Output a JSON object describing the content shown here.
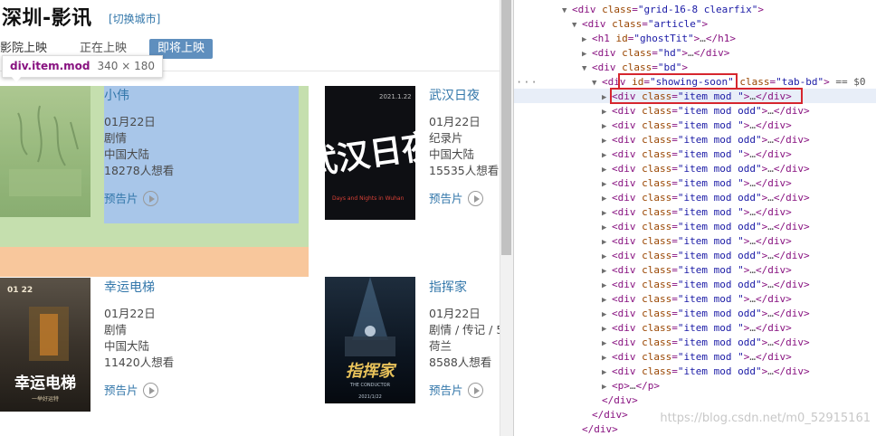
{
  "header": {
    "city_title": "深圳-影讯",
    "switch_city": "[切换城市]",
    "tabs": [
      "影院上映",
      "正在上映",
      "即将上映"
    ]
  },
  "tooltip": {
    "selector": "div.item.mod",
    "size": "340 × 180"
  },
  "movies": [
    {
      "title": "小伟",
      "date": "01月22日",
      "genre": "剧情",
      "region": "中国大陆",
      "wish": "18278人想看",
      "trailer": "预告片"
    },
    {
      "title": "武汉日夜",
      "date": "01月22日",
      "genre": "纪录片",
      "region": "中国大陆",
      "wish": "15535人想看",
      "trailer": "预告片"
    },
    {
      "title": "幸运电梯",
      "date": "01月22日",
      "genre": "剧情",
      "region": "中国大陆",
      "wish": "11420人想看",
      "trailer": "预告片"
    },
    {
      "title": "指挥家",
      "date": "01月22日",
      "genre": "剧情 / 传记 / 5",
      "region": "荷兰",
      "wish": "8588人想看",
      "trailer": "预告片"
    }
  ],
  "poster_text": {
    "p2_top": "2021.1.22",
    "p2_big": "武汉日夜",
    "p2_en": "Days and Nights in Wuhan",
    "p3_date": "01 22",
    "p3_big": "幸运电梯",
    "p3_sub": "一举好运特",
    "p4_big": "指挥家",
    "p4_en": "THE CONDUCTOR",
    "p4_date": "2021/1/22"
  },
  "devtools": {
    "lines": [
      {
        "indent": 0,
        "tri": "▼",
        "tag": "div",
        "attrs": [
          [
            "class",
            "grid-16-8 clearfix"
          ]
        ],
        "tail": ">"
      },
      {
        "indent": 1,
        "tri": "▼",
        "tag": "div",
        "attrs": [
          [
            "class",
            "article"
          ]
        ],
        "tail": ">"
      },
      {
        "indent": 2,
        "tri": "▶",
        "tag": "h1",
        "attrs": [
          [
            "id",
            "ghostTit"
          ]
        ],
        "tail": ">…</h1>"
      },
      {
        "indent": 2,
        "tri": "▶",
        "tag": "div",
        "attrs": [
          [
            "class",
            "hd"
          ]
        ],
        "tail": ">…</div>"
      },
      {
        "indent": 2,
        "tri": "▼",
        "tag": "div",
        "attrs": [
          [
            "class",
            "bd"
          ]
        ],
        "tail": ">"
      },
      {
        "indent": 3,
        "tri": "▼",
        "tag": "div",
        "attrs": [
          [
            "id",
            "showing-soon"
          ],
          [
            "class",
            "tab-bd"
          ]
        ],
        "tail": "> == $0"
      },
      {
        "indent": 4,
        "tri": "▶",
        "tag": "div",
        "attrs": [
          [
            "class",
            "item mod "
          ]
        ],
        "tail": ">…</div>"
      },
      {
        "indent": 4,
        "tri": "▶",
        "tag": "div",
        "attrs": [
          [
            "class",
            "item mod odd"
          ]
        ],
        "tail": ">…</div>"
      },
      {
        "indent": 4,
        "tri": "▶",
        "tag": "div",
        "attrs": [
          [
            "class",
            "item mod "
          ]
        ],
        "tail": ">…</div>"
      },
      {
        "indent": 4,
        "tri": "▶",
        "tag": "div",
        "attrs": [
          [
            "class",
            "item mod odd"
          ]
        ],
        "tail": ">…</div>"
      },
      {
        "indent": 4,
        "tri": "▶",
        "tag": "div",
        "attrs": [
          [
            "class",
            "item mod "
          ]
        ],
        "tail": ">…</div>"
      },
      {
        "indent": 4,
        "tri": "▶",
        "tag": "div",
        "attrs": [
          [
            "class",
            "item mod odd"
          ]
        ],
        "tail": ">…</div>"
      },
      {
        "indent": 4,
        "tri": "▶",
        "tag": "div",
        "attrs": [
          [
            "class",
            "item mod "
          ]
        ],
        "tail": ">…</div>"
      },
      {
        "indent": 4,
        "tri": "▶",
        "tag": "div",
        "attrs": [
          [
            "class",
            "item mod odd"
          ]
        ],
        "tail": ">…</div>"
      },
      {
        "indent": 4,
        "tri": "▶",
        "tag": "div",
        "attrs": [
          [
            "class",
            "item mod "
          ]
        ],
        "tail": ">…</div>"
      },
      {
        "indent": 4,
        "tri": "▶",
        "tag": "div",
        "attrs": [
          [
            "class",
            "item mod odd"
          ]
        ],
        "tail": ">…</div>"
      },
      {
        "indent": 4,
        "tri": "▶",
        "tag": "div",
        "attrs": [
          [
            "class",
            "item mod "
          ]
        ],
        "tail": ">…</div>"
      },
      {
        "indent": 4,
        "tri": "▶",
        "tag": "div",
        "attrs": [
          [
            "class",
            "item mod odd"
          ]
        ],
        "tail": ">…</div>"
      },
      {
        "indent": 4,
        "tri": "▶",
        "tag": "div",
        "attrs": [
          [
            "class",
            "item mod "
          ]
        ],
        "tail": ">…</div>"
      },
      {
        "indent": 4,
        "tri": "▶",
        "tag": "div",
        "attrs": [
          [
            "class",
            "item mod odd"
          ]
        ],
        "tail": ">…</div>"
      },
      {
        "indent": 4,
        "tri": "▶",
        "tag": "div",
        "attrs": [
          [
            "class",
            "item mod "
          ]
        ],
        "tail": ">…</div>"
      },
      {
        "indent": 4,
        "tri": "▶",
        "tag": "div",
        "attrs": [
          [
            "class",
            "item mod odd"
          ]
        ],
        "tail": ">…</div>"
      },
      {
        "indent": 4,
        "tri": "▶",
        "tag": "div",
        "attrs": [
          [
            "class",
            "item mod "
          ]
        ],
        "tail": ">…</div>"
      },
      {
        "indent": 4,
        "tri": "▶",
        "tag": "div",
        "attrs": [
          [
            "class",
            "item mod odd"
          ]
        ],
        "tail": ">…</div>"
      },
      {
        "indent": 4,
        "tri": "▶",
        "tag": "div",
        "attrs": [
          [
            "class",
            "item mod "
          ]
        ],
        "tail": ">…</div>"
      },
      {
        "indent": 4,
        "tri": "▶",
        "tag": "div",
        "attrs": [
          [
            "class",
            "item mod odd"
          ]
        ],
        "tail": ">…</div>"
      },
      {
        "indent": 4,
        "tri": "▶",
        "tag": "p",
        "attrs": [],
        "tail": ">…</p>"
      },
      {
        "indent": 3,
        "tri": "",
        "tag": "/div",
        "attrs": [],
        "tail": ">"
      },
      {
        "indent": 2,
        "tri": "",
        "tag": "/div",
        "attrs": [],
        "tail": ">"
      },
      {
        "indent": 1,
        "tri": "",
        "tag": "/div",
        "attrs": [],
        "tail": ">"
      }
    ],
    "watermark": "https://blog.csdn.net/m0_52915161"
  },
  "colors": {
    "link": "#3377aa",
    "highlight_margin": "#c5dfae",
    "highlight_content": "#a8c6e9",
    "highlight_bottom": "#f8c79c",
    "active_tab": "#5f8fbe",
    "redbox": "#d6262e"
  }
}
